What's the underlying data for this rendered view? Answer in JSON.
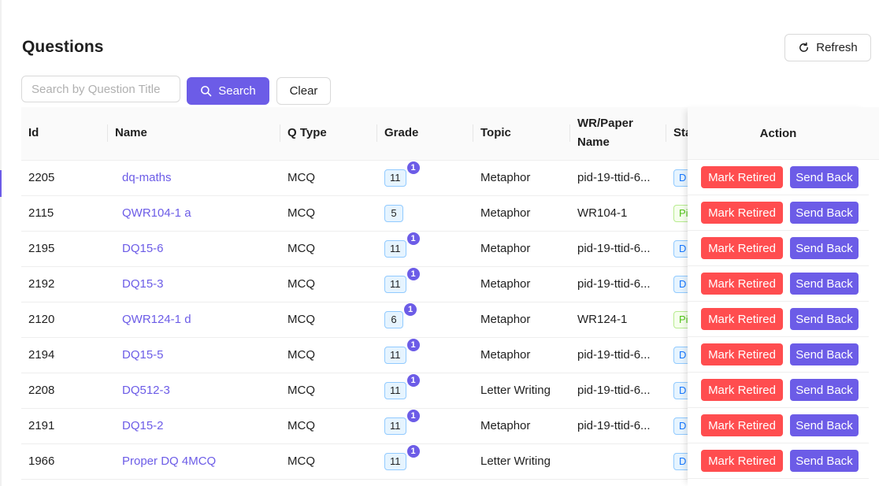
{
  "page": {
    "title": "Questions"
  },
  "toolbar": {
    "refresh_label": "Refresh",
    "search_placeholder": "Search by Question Title",
    "search_value": "",
    "search_label": "Search",
    "clear_label": "Clear"
  },
  "table": {
    "columns": {
      "id": "Id",
      "name": "Name",
      "qtype": "Q Type",
      "grade": "Grade",
      "topic": "Topic",
      "paper": "WR/Paper Name",
      "status": "Sta",
      "action": "Action"
    },
    "rows": [
      {
        "id": "2205",
        "name": "dq-maths",
        "qtype": "MCQ",
        "grade": "11",
        "grade_count": "1",
        "topic": "Metaphor",
        "paper": "pid-19-ttid-6...",
        "status": "D",
        "status_color": "blue"
      },
      {
        "id": "2115",
        "name": "QWR104-1 a",
        "qtype": "MCQ",
        "grade": "5",
        "grade_count": "",
        "topic": "Metaphor",
        "paper": "WR104-1",
        "status": "Pi",
        "status_color": "green"
      },
      {
        "id": "2195",
        "name": "DQ15-6",
        "qtype": "MCQ",
        "grade": "11",
        "grade_count": "1",
        "topic": "Metaphor",
        "paper": "pid-19-ttid-6...",
        "status": "D",
        "status_color": "blue"
      },
      {
        "id": "2192",
        "name": "DQ15-3",
        "qtype": "MCQ",
        "grade": "11",
        "grade_count": "1",
        "topic": "Metaphor",
        "paper": "pid-19-ttid-6...",
        "status": "D",
        "status_color": "blue"
      },
      {
        "id": "2120",
        "name": "QWR124-1 d",
        "qtype": "MCQ",
        "grade": "6",
        "grade_count": "1",
        "topic": "Metaphor",
        "paper": "WR124-1",
        "status": "Pi",
        "status_color": "green"
      },
      {
        "id": "2194",
        "name": "DQ15-5",
        "qtype": "MCQ",
        "grade": "11",
        "grade_count": "1",
        "topic": "Metaphor",
        "paper": "pid-19-ttid-6...",
        "status": "D",
        "status_color": "blue"
      },
      {
        "id": "2208",
        "name": "DQ512-3",
        "qtype": "MCQ",
        "grade": "11",
        "grade_count": "1",
        "topic": "Letter Writing",
        "paper": "pid-19-ttid-6...",
        "status": "D",
        "status_color": "blue"
      },
      {
        "id": "2191",
        "name": "DQ15-2",
        "qtype": "MCQ",
        "grade": "11",
        "grade_count": "1",
        "topic": "Metaphor",
        "paper": "pid-19-ttid-6...",
        "status": "D",
        "status_color": "blue"
      },
      {
        "id": "1966",
        "name": "Proper DQ 4MCQ",
        "qtype": "MCQ",
        "grade": "11",
        "grade_count": "1",
        "topic": "Letter Writing",
        "paper": "",
        "status": "D",
        "status_color": "blue"
      }
    ],
    "actions": {
      "retire_label": "Mark Retired",
      "send_back_label": "Send Back"
    }
  },
  "colors": {
    "accent": "#6c5ce7",
    "danger": "#ff4d4f",
    "status_blue": "#1677ff",
    "status_green": "#52c41a"
  },
  "icons": {
    "refresh": "refresh-icon",
    "search": "search-icon"
  }
}
